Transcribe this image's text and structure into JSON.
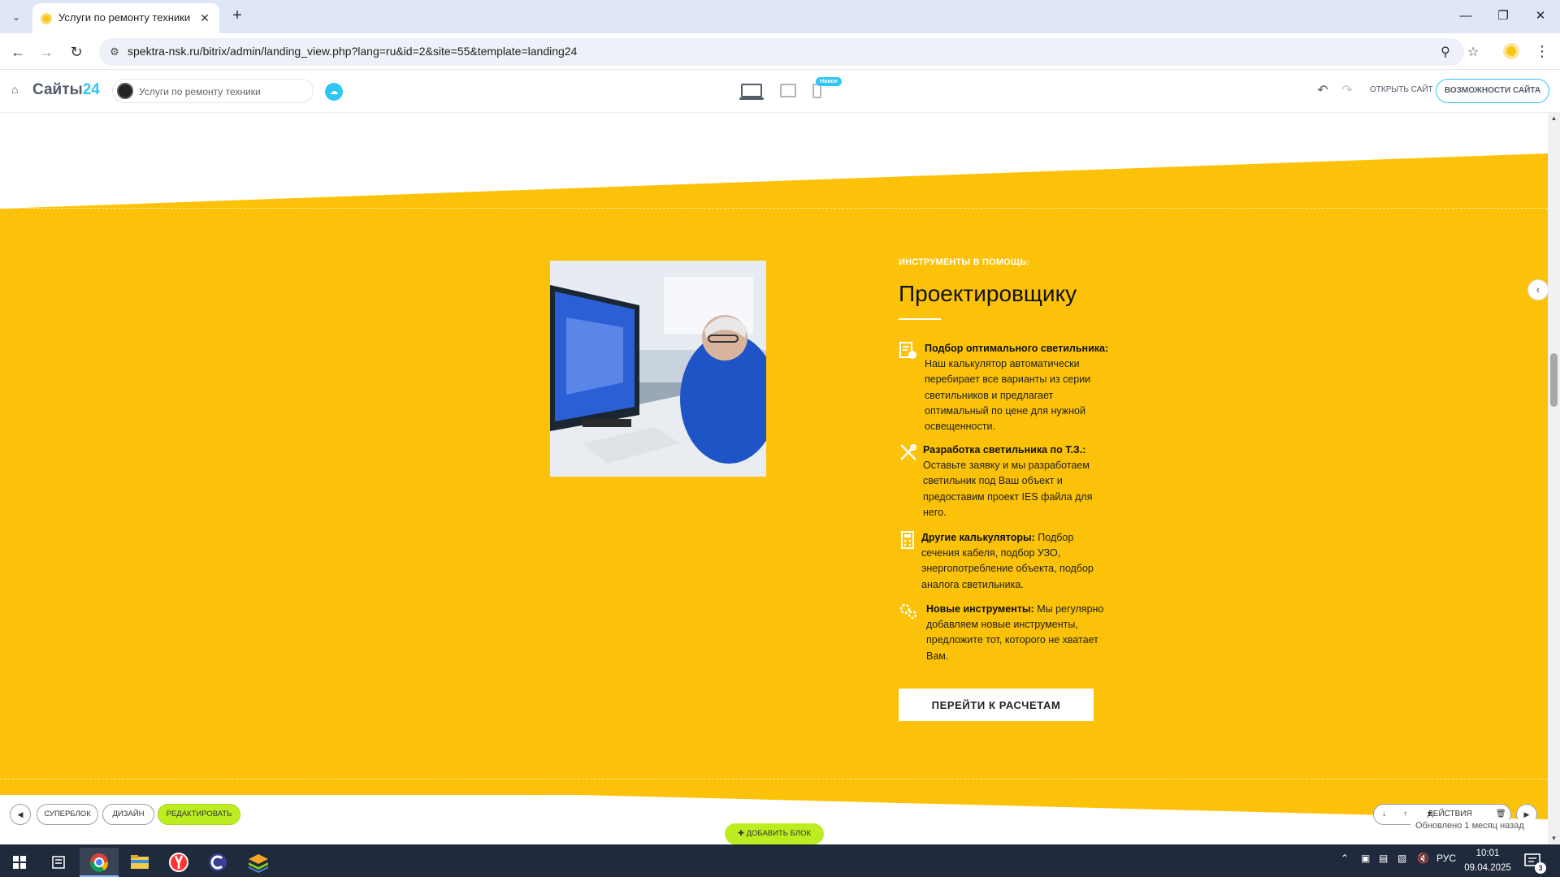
{
  "browser": {
    "tab_title": "Услуги по ремонту техники",
    "url": "spektra-nsk.ru/bitrix/admin/landing_view.php?lang=ru&id=2&site=55&template=landing24",
    "new_tab_symbol": "+",
    "close_symbol": "✕"
  },
  "bitrix_panel": {
    "logo_text": "Сайты",
    "logo_number": "24",
    "site_name": "Услуги по ремонту техники",
    "badge_new": "Новое",
    "open_site_label": "ОТКРЫТЬ САЙТ",
    "features_label": "ВОЗМОЖНОСТИ САЙТА"
  },
  "section": {
    "subtitle": "ИНСТРУМЕНТЫ В ПОМОЩЬ:",
    "heading": "Проектировщику",
    "features": [
      {
        "icon": "document-check-icon",
        "title": "Подбор оптимального светильника:",
        "text": " Наш калькулятор автоматически перебирает все варианты из серии светильников и предлагает оптимальный по цене для нужной освещенности."
      },
      {
        "icon": "drafting-tools-icon",
        "title": "Разработка светильника по Т.З.:",
        "text": " Оставьте заявку и мы разработаем светильник под Ваш объект и предоставим проект IES файла для него."
      },
      {
        "icon": "calculator-icon",
        "title": "Другие калькуляторы:",
        "text": " Подбор сечения кабеля, подбор УЗО, энергопотребление объекта, подбор аналога светильника."
      },
      {
        "icon": "gears-icon",
        "title": "Новые инструменты:",
        "text": " Мы регулярно добавляем новые инструменты, предложите тот, которого не хватает Вам."
      }
    ],
    "cta_label": "ПЕРЕЙТИ К РАСЧЕТАМ",
    "accent_color": "#fbc209"
  },
  "block_controls": {
    "superblock_label": "СУПЕРБЛОК",
    "design_label": "ДИЗАЙН",
    "edit_label": "РЕДАКТИРОВАТЬ",
    "add_block_label": "ДОБАВИТЬ БЛОК",
    "actions_label": "ДЕЙСТВИЯ",
    "updated_text": "Обновлено 1 месяц назад"
  },
  "taskbar": {
    "language": "РУС",
    "time": "10:01",
    "date": "09.04.2025",
    "notifications_count": "3"
  }
}
